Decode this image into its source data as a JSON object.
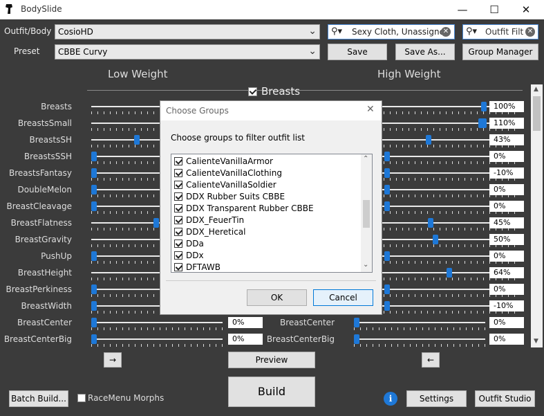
{
  "window": {
    "title": "BodySlide",
    "minimize": "—",
    "maximize": "☐",
    "close": "✕"
  },
  "top": {
    "outfit_label": "Outfit/Body",
    "outfit_value": "CosioHD",
    "preset_label": "Preset",
    "preset_value": "CBBE Curvy",
    "group_search": "Sexy Cloth, Unassigned",
    "outfit_filter_placeholder": "Outfit Filte",
    "save": "Save",
    "save_as": "Save As...",
    "group_manager": "Group Manager"
  },
  "columns": {
    "low": "Low Weight",
    "high": "High Weight",
    "category": "Breasts"
  },
  "sliders": [
    {
      "name": "Breasts",
      "low": 0.21,
      "high": 1.0,
      "value": "100%"
    },
    {
      "name": "BreastsSmall",
      "low": 1.0,
      "high": 1.0,
      "value": "110%"
    },
    {
      "name": "BreastsSH",
      "low": 0.11,
      "high": 0.43,
      "value": "43%"
    },
    {
      "name": "BreastsSSH",
      "low": 0.0,
      "high": 0.0,
      "value": "0%"
    },
    {
      "name": "BreastsFantasy",
      "low": 0.0,
      "high": 0.0,
      "value": "-10%"
    },
    {
      "name": "DoubleMelon",
      "low": 0.0,
      "high": 0.0,
      "value": "0%"
    },
    {
      "name": "BreastCleavage",
      "low": 0.0,
      "high": 0.0,
      "value": "0%"
    },
    {
      "name": "BreastFlatness",
      "low": 0.16,
      "high": 0.45,
      "value": "45%"
    },
    {
      "name": "BreastGravity",
      "low": 0.3,
      "high": 0.5,
      "value": "50%"
    },
    {
      "name": "PushUp",
      "low": 0.0,
      "high": 0.0,
      "value": "0%"
    },
    {
      "name": "BreastHeight",
      "low": 0.44,
      "high": 0.64,
      "value": "64%"
    },
    {
      "name": "BreastPerkiness",
      "low": 0.0,
      "high": 0.0,
      "value": "0%"
    },
    {
      "name": "BreastWidth",
      "low": 0.0,
      "high": 0.0,
      "value": "-10%"
    },
    {
      "name": "BreastCenter",
      "low": 0.0,
      "high": 0.0,
      "value": "0%",
      "low_value": "0%"
    },
    {
      "name": "BreastCenterBig",
      "low": 0.0,
      "high": 0.0,
      "value": "0%",
      "low_value": "0%"
    }
  ],
  "bottom": {
    "arrow_right": "→",
    "arrow_left": "←",
    "preview": "Preview",
    "build": "Build",
    "batch_build": "Batch Build...",
    "racemenu": "RaceMenu Morphs",
    "settings": "Settings",
    "outfit_studio": "Outfit Studio",
    "info": "i"
  },
  "dialog": {
    "title": "Choose Groups",
    "prompt": "Choose groups to filter outfit list",
    "ok": "OK",
    "cancel": "Cancel",
    "groups": [
      "CalienteVanillaArmor",
      "CalienteVanillaClothing",
      "CalienteVanillaSoldier",
      "DDX Rubber Suits CBBE",
      "DDX Transparent Rubber CBBE",
      "DDX_FeuerTin",
      "DDX_Heretical",
      "DDa",
      "DDx",
      "DFTAWB"
    ]
  }
}
